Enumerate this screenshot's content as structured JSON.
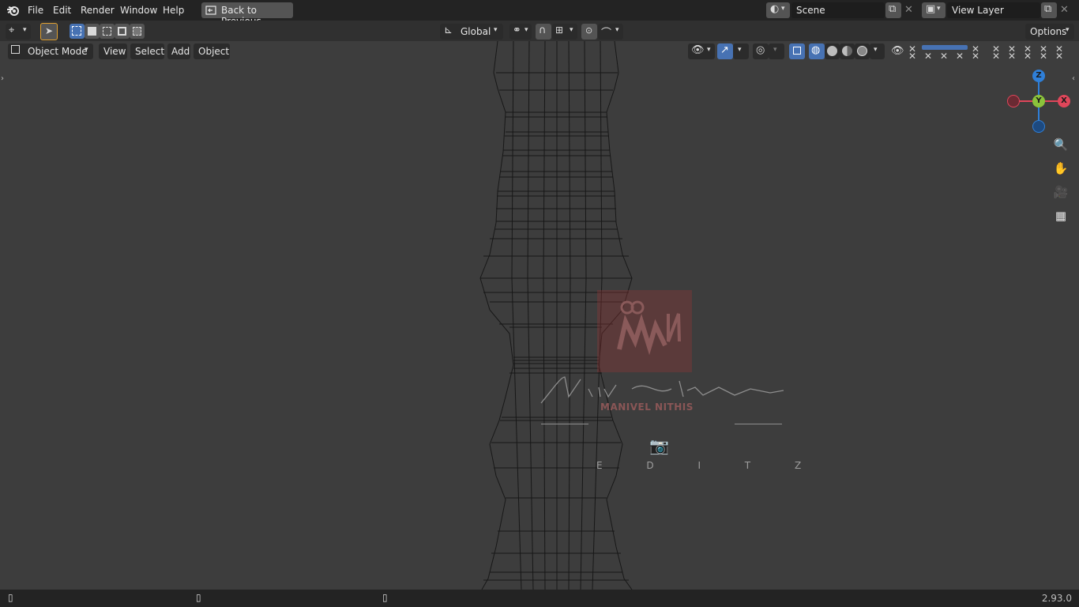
{
  "menubar": {
    "items": [
      "File",
      "Edit",
      "Render",
      "Window",
      "Help"
    ],
    "back_button": "Back to Previous",
    "scene_field": "Scene",
    "view_layer_field": "View Layer"
  },
  "toolrow": {
    "orientation": "Global",
    "options_label": "Options"
  },
  "header": {
    "mode": "Object Mode",
    "menus": [
      "View",
      "Select",
      "Add",
      "Object"
    ]
  },
  "gizmo": {
    "axes": [
      "Z",
      "Y",
      "X"
    ],
    "colors": {
      "x": "#e0465a",
      "y": "#8bc33b",
      "z": "#2f7fd8"
    }
  },
  "watermark": {
    "name": "MANIVEL NITHIS",
    "signature": "Nithis Kumar",
    "editz": "E D I T Z"
  },
  "status": {
    "version": "2.93.0"
  },
  "colors": {
    "accent_blue": "#4772b3",
    "topbar": "#232323",
    "viewport": "#3d3d3d"
  }
}
